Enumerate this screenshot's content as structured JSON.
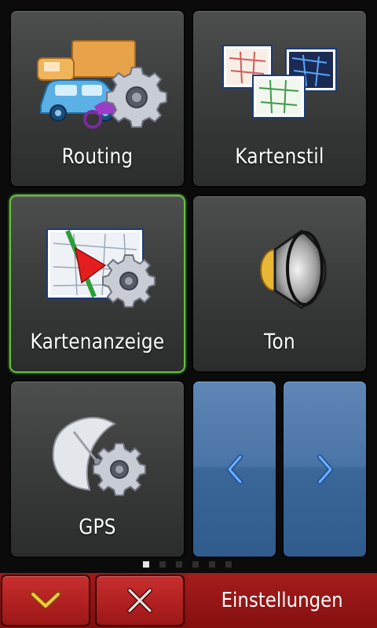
{
  "tiles": {
    "routing": {
      "label": "Routing",
      "icon": "vehicles-gear-icon"
    },
    "kartenstil": {
      "label": "Kartenstil",
      "icon": "map-styles-icon"
    },
    "kartenanzeige": {
      "label": "Kartenanzeige",
      "icon": "map-display-gear-icon",
      "selected": true
    },
    "ton": {
      "label": "Ton",
      "icon": "speaker-icon"
    },
    "gps": {
      "label": "GPS",
      "icon": "satellite-dish-gear-icon"
    }
  },
  "navigation": {
    "previous_icon": "chevron-left-icon",
    "next_icon": "chevron-right-icon"
  },
  "pager": {
    "pages": 6,
    "current": 1
  },
  "bottom_bar": {
    "collapse_icon": "chevron-down-icon",
    "close_icon": "close-icon",
    "title": "Einstellungen"
  },
  "colors": {
    "selected_border": "#5fc23a",
    "nav_blue": "#3b6698",
    "bar_red": "#9c1717"
  }
}
